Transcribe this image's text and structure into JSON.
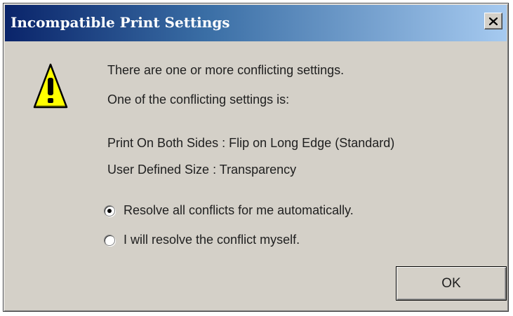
{
  "window": {
    "title": "Incompatible Print Settings",
    "close_icon": "close-icon"
  },
  "message": {
    "icon": "warning-icon",
    "line1": "There are one or more conflicting settings.",
    "line2": "One of the conflicting settings is:",
    "conflict1": "Print On Both Sides : Flip on Long Edge (Standard)",
    "conflict2": "User Defined Size : Transparency"
  },
  "options": [
    {
      "label": "Resolve all conflicts for me automatically.",
      "selected": true
    },
    {
      "label": "I will resolve the conflict myself.",
      "selected": false
    }
  ],
  "buttons": {
    "ok_label": "OK"
  },
  "colors": {
    "title_gradient_start": "#0a246a",
    "title_gradient_end": "#a6caf0",
    "dialog_face": "#d4d0c8",
    "warning_fill": "#ffff00"
  }
}
